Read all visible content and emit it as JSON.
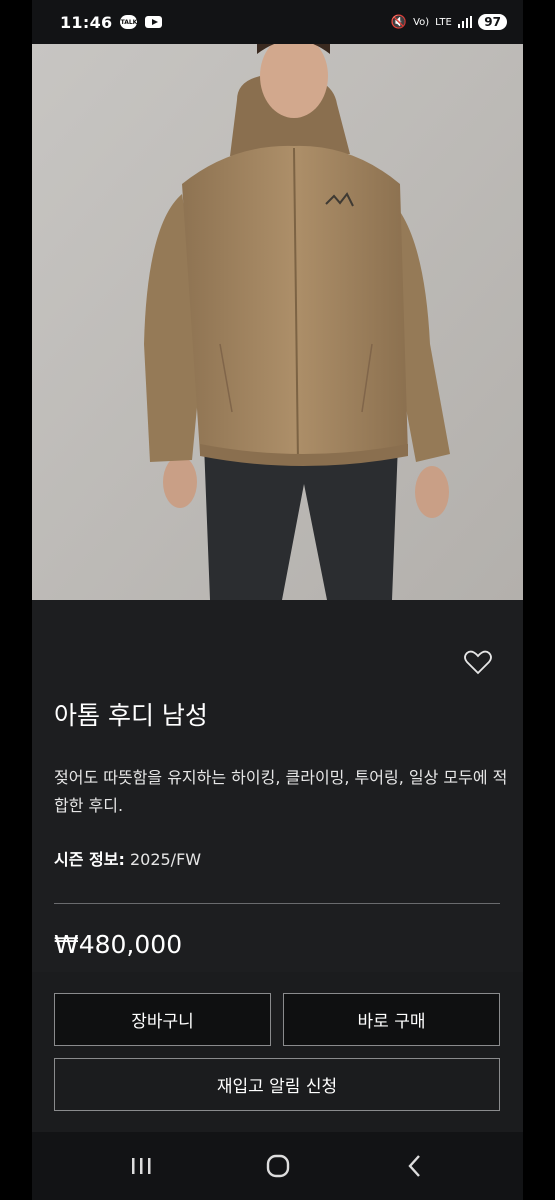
{
  "status_bar": {
    "time": "11:46",
    "talk_badge": "TALK",
    "network": "LTE",
    "volte": "Vo)",
    "battery": "97"
  },
  "product": {
    "image_alt": "Arc'teryx tan hooded jacket worn by model",
    "title": "아톰 후디 남성",
    "description": "젖어도 따뜻함을 유지하는 하이킹, 클라이밍, 투어링, 일상 모두에 적합한 후디.",
    "season_label": "시즌 정보:",
    "season_value": "2025/FW",
    "price": "₩480,000"
  },
  "actions": {
    "cart_label": "장바구니",
    "buy_now_label": "바로 구매",
    "restock_label": "재입고 알림 신청"
  },
  "colors": {
    "background": "#1d1e20",
    "jacket": "#a48763",
    "button_bg": "#0f1011",
    "button_border": "#8a8b8d"
  }
}
